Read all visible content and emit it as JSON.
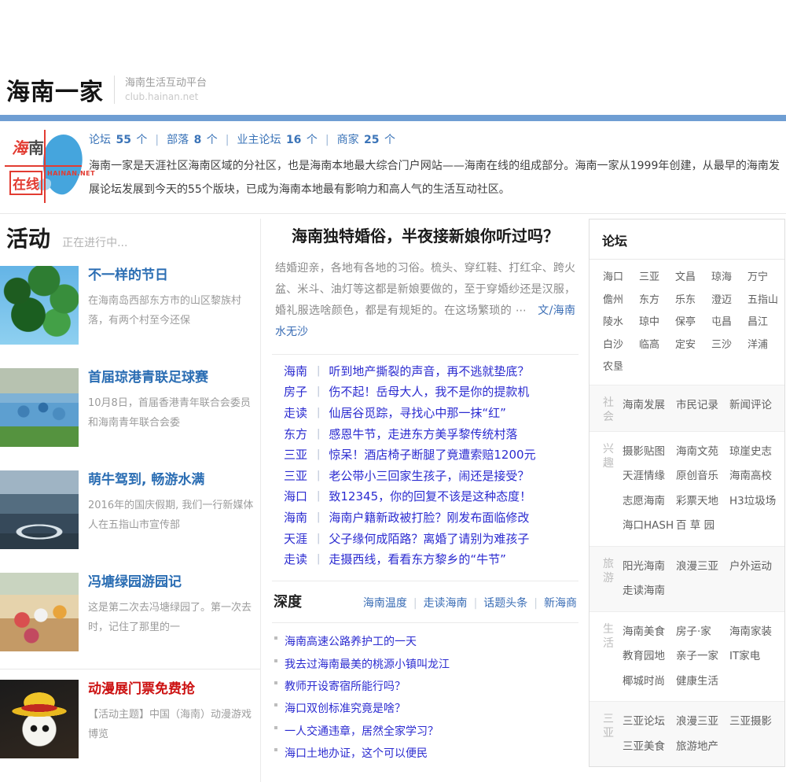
{
  "header": {
    "logo": "海南一家",
    "tagline": "海南生活互动平台",
    "url": "club.hainan.net"
  },
  "intro": {
    "badge": {
      "c1": "海",
      "c2": "南",
      "c3": "在",
      "c4": "线",
      "net": "HAINAN.NET"
    },
    "stats": [
      {
        "label": "论坛",
        "count": "55",
        "unit": "个"
      },
      {
        "label": "部落",
        "count": "8",
        "unit": "个"
      },
      {
        "label": "业主论坛",
        "count": "16",
        "unit": "个"
      },
      {
        "label": "商家",
        "count": "25",
        "unit": "个"
      }
    ],
    "description": "海南一家是天涯社区海南区域的分社区，也是海南本地最大综合门户网站——海南在线的组成部分。海南一家从1999年创建，从最早的海南发展论坛发展到今天的55个版块，已成为海南本地最有影响力和高人气的生活互动社区。"
  },
  "activities": {
    "title": "活动",
    "subtitle": "正在进行中...",
    "items": [
      {
        "title": "不一样的节日",
        "desc": "在海南岛西部东方市的山区黎族村落，有两个村至今还保"
      },
      {
        "title": "首届琼港青联足球赛",
        "desc": "10月8日，首届香港青年联合会委员和海南青年联合会委"
      },
      {
        "title": "萌牛驾到, 畅游水满",
        "desc": "2016年的国庆假期, 我们一行新媒体人在五指山市宣传部"
      },
      {
        "title": "冯塘绿园游园记",
        "desc": "这是第二次去冯塘绿园了。第一次去时，记住了那里的一"
      },
      {
        "title": "动漫展门票免费抢",
        "desc": "【活动主题】中国（海南）动漫游戏博览"
      }
    ]
  },
  "feature": {
    "title": "海南独特婚俗，半夜接新娘你听过吗？",
    "summary": "结婚迎亲，各地有各地的习俗。梳头、穿红鞋、打红伞、跨火盆、米斗、油灯等这都是新娘要做的，至于穿婚纱还是汉服，婚礼服选啥颜色，都是有规矩的。在这场繁琐的 ⋯",
    "author": "文/海南水无沙"
  },
  "news": [
    {
      "cat": "海南",
      "title": "听到地产撕裂的声音，再不逃就垫底？"
    },
    {
      "cat": "房子",
      "title": "伤不起！岳母大人，我不是你的提款机"
    },
    {
      "cat": "走读",
      "title": "仙居谷觅踪，寻找心中那一抹“红”"
    },
    {
      "cat": "东方",
      "title": "感恩牛节，走进东方美孚黎传统村落"
    },
    {
      "cat": "三亚",
      "title": "惊呆！酒店椅子断腿了竟遭索赔1200元"
    },
    {
      "cat": "三亚",
      "title": "老公带小三回家生孩子，闹还是接受？"
    },
    {
      "cat": "海口",
      "title": "致12345，你的回复不该是这种态度！"
    },
    {
      "cat": "海南",
      "title": "海南户籍新政被打脸？刚发布面临修改"
    },
    {
      "cat": "天涯",
      "title": "父子缘何成陌路？离婚了请别为难孩子"
    },
    {
      "cat": "走读",
      "title": "走摄西线，看看东方黎乡的“牛节”"
    }
  ],
  "depth": {
    "title": "深度",
    "tabs": [
      "海南温度",
      "走读海南",
      "话题头条",
      "新海商"
    ],
    "items": [
      "海南高速公路养护工的一天",
      "我去过海南最美的桃源小镇叫龙江",
      "教师开设寄宿所能行吗？",
      "海口双创标准究竟是啥？",
      "一人交通违章，居然全家学习？",
      "海口土地办证，这个可以便民"
    ]
  },
  "forum": {
    "title": "论坛",
    "cities": [
      "海口",
      "三亚",
      "文昌",
      "琼海",
      "万宁",
      "儋州",
      "东方",
      "乐东",
      "澄迈",
      "五指山",
      "陵水",
      "琼中",
      "保亭",
      "屯昌",
      "昌江",
      "白沙",
      "临高",
      "定安",
      "三沙",
      "洋浦",
      "农垦"
    ],
    "sections": [
      {
        "label": "社会",
        "links": [
          "海南发展",
          "市民记录",
          "新闻评论"
        ]
      },
      {
        "label": "兴趣",
        "links": [
          "摄影贴图",
          "海南文苑",
          "琼崖史志",
          "天涯情缘",
          "原创音乐",
          "海南高校",
          "志愿海南",
          "彩票天地",
          "H3垃圾场",
          "海口HASH",
          "百 草 园"
        ]
      },
      {
        "label": "旅游",
        "links": [
          "阳光海南",
          "浪漫三亚",
          "户外运动",
          "走读海南"
        ]
      },
      {
        "label": "生活",
        "links": [
          "海南美食",
          "房子·家",
          "海南家装",
          "教育园地",
          "亲子一家",
          "IT家电",
          "椰城时尚",
          "健康生活"
        ]
      },
      {
        "label": "三亚",
        "links": [
          "三亚论坛",
          "浪漫三亚",
          "三亚摄影",
          "三亚美食",
          "旅游地产"
        ]
      }
    ]
  },
  "colors": {
    "accent_bar": "#6f9ed3",
    "link_blue": "#2b2bd0",
    "steel_blue": "#3a6db5",
    "red": "#cc1111"
  }
}
